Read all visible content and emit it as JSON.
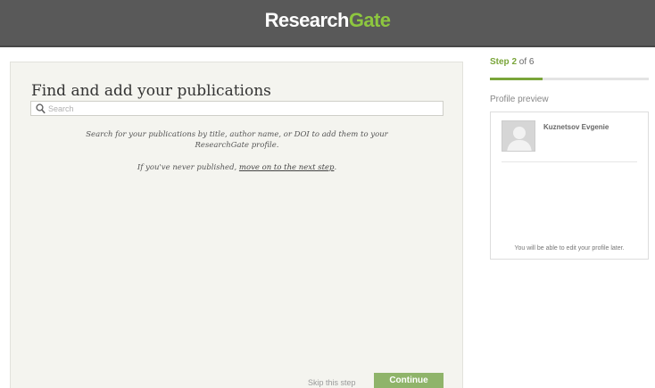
{
  "header": {
    "logo_part1": "Research",
    "logo_part2": "Gate",
    "colors": {
      "bar": "#595959",
      "accent": "#8dc63f"
    }
  },
  "main": {
    "title": "Find and add your publications",
    "search": {
      "placeholder": "Search",
      "value": "",
      "icon": "search-icon"
    },
    "help_line_1": "Search for your publications by title, author name, or DOI to add them to your",
    "help_line_2": "ResearchGate profile.",
    "help_never_published": "If you've never published, ",
    "help_link": "move on to the next step",
    "help_period": ".",
    "skip_label": "Skip this step",
    "continue_label": "Continue"
  },
  "sidebar": {
    "step_label": "Step 2",
    "step_of": " of 6",
    "step_progress": 0.333,
    "preview_title": "Profile preview",
    "profile_name": "Kuznetsov Evgenie",
    "card_note": "You will be able to edit your profile later."
  }
}
